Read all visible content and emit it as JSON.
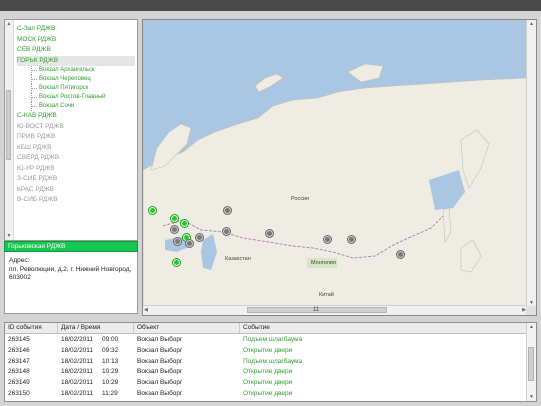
{
  "tree": {
    "items": [
      {
        "label": "С-Зап РДЖВ",
        "state": "active"
      },
      {
        "label": "МОСК РДЖВ",
        "state": "active"
      },
      {
        "label": "СЕВ РДЖВ",
        "state": "active"
      },
      {
        "label": "ГОРЬК РДЖВ",
        "state": "active",
        "selected": true
      },
      {
        "label": "Вокзал Архангельск",
        "child": true
      },
      {
        "label": "Вокзал Череповец",
        "child": true
      },
      {
        "label": "Вокзал Пятигорск",
        "child": true
      },
      {
        "label": "Вокзал Ростов-Главный",
        "child": true
      },
      {
        "label": "Вокзал Сочи",
        "child": true
      },
      {
        "label": "С-КАВ РДЖВ",
        "state": "active"
      },
      {
        "label": "Ю-ВОСТ РДЖВ",
        "state": "inactive"
      },
      {
        "label": "ПРИВ РДЖВ",
        "state": "inactive"
      },
      {
        "label": "КБШ РДЖВ",
        "state": "inactive"
      },
      {
        "label": "СВЕРД РДЖВ",
        "state": "inactive"
      },
      {
        "label": "Ю-УР РДЖВ",
        "state": "inactive"
      },
      {
        "label": "З-СИБ РДЖВ",
        "state": "inactive"
      },
      {
        "label": "КРАС РДЖВ",
        "state": "inactive"
      },
      {
        "label": "В-СИБ РДЖВ",
        "state": "inactive"
      }
    ]
  },
  "info": {
    "header": "Горьковская РДЖВ",
    "address_label": "Адрес:",
    "address": "пл. Революции, д.2, г. Нижний Новгород, 603002"
  },
  "map": {
    "labels": {
      "russia": "Россия",
      "kazakhstan": "Казахстан",
      "mongolia": "Монголия",
      "china": "Китай",
      "scale": "11"
    },
    "colors": {
      "water": "#a9c7e3",
      "land": "#efece3",
      "green_marker": "#2cc52c",
      "gray_marker": "#777777"
    }
  },
  "events": {
    "headers": [
      "ID события",
      "Дата / Время",
      "Объект",
      "Событие"
    ],
    "rows": [
      {
        "id": "263145",
        "date": "18/02/2011",
        "time": "09:00",
        "object": "Вокзал Выборг",
        "event": "Подъем шлагбаума"
      },
      {
        "id": "263146",
        "date": "18/02/2011",
        "time": "09:32",
        "object": "Вокзал Выборг",
        "event": "Открытие двери"
      },
      {
        "id": "263147",
        "date": "18/02/2011",
        "time": "10:13",
        "object": "Вокзал Выборг",
        "event": "Подъем шлагбаума"
      },
      {
        "id": "263148",
        "date": "18/02/2011",
        "time": "10:29",
        "object": "Вокзал Выборг",
        "event": "Открытие двери"
      },
      {
        "id": "263149",
        "date": "18/02/2011",
        "time": "10:29",
        "object": "Вокзал Выборг",
        "event": "Открытие двери"
      },
      {
        "id": "263150",
        "date": "18/02/2011",
        "time": "11:29",
        "object": "Вокзал Выборг",
        "event": "Открытие двери"
      }
    ]
  }
}
